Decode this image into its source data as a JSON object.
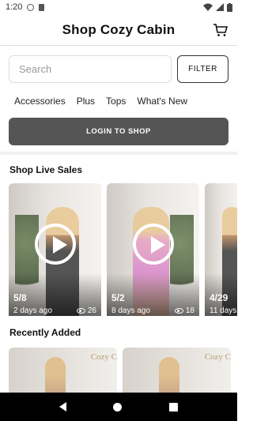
{
  "status": {
    "time": "1:20"
  },
  "header": {
    "title": "Shop Cozy Cabin"
  },
  "search": {
    "placeholder": "Search",
    "filter_label": "FILTER"
  },
  "categories": [
    "Accessories",
    "Plus",
    "Tops",
    "What's New"
  ],
  "login": {
    "label": "LOGIN TO SHOP"
  },
  "live": {
    "title": "Shop Live Sales",
    "cards": [
      {
        "date": "5/8",
        "ago": "2 days ago",
        "views": "26"
      },
      {
        "date": "5/2",
        "ago": "8 days ago",
        "views": "18"
      },
      {
        "date": "4/29",
        "ago": "11 days",
        "views": ""
      }
    ]
  },
  "recent": {
    "title": "Recently Added",
    "logo_text": "Cozy C"
  }
}
